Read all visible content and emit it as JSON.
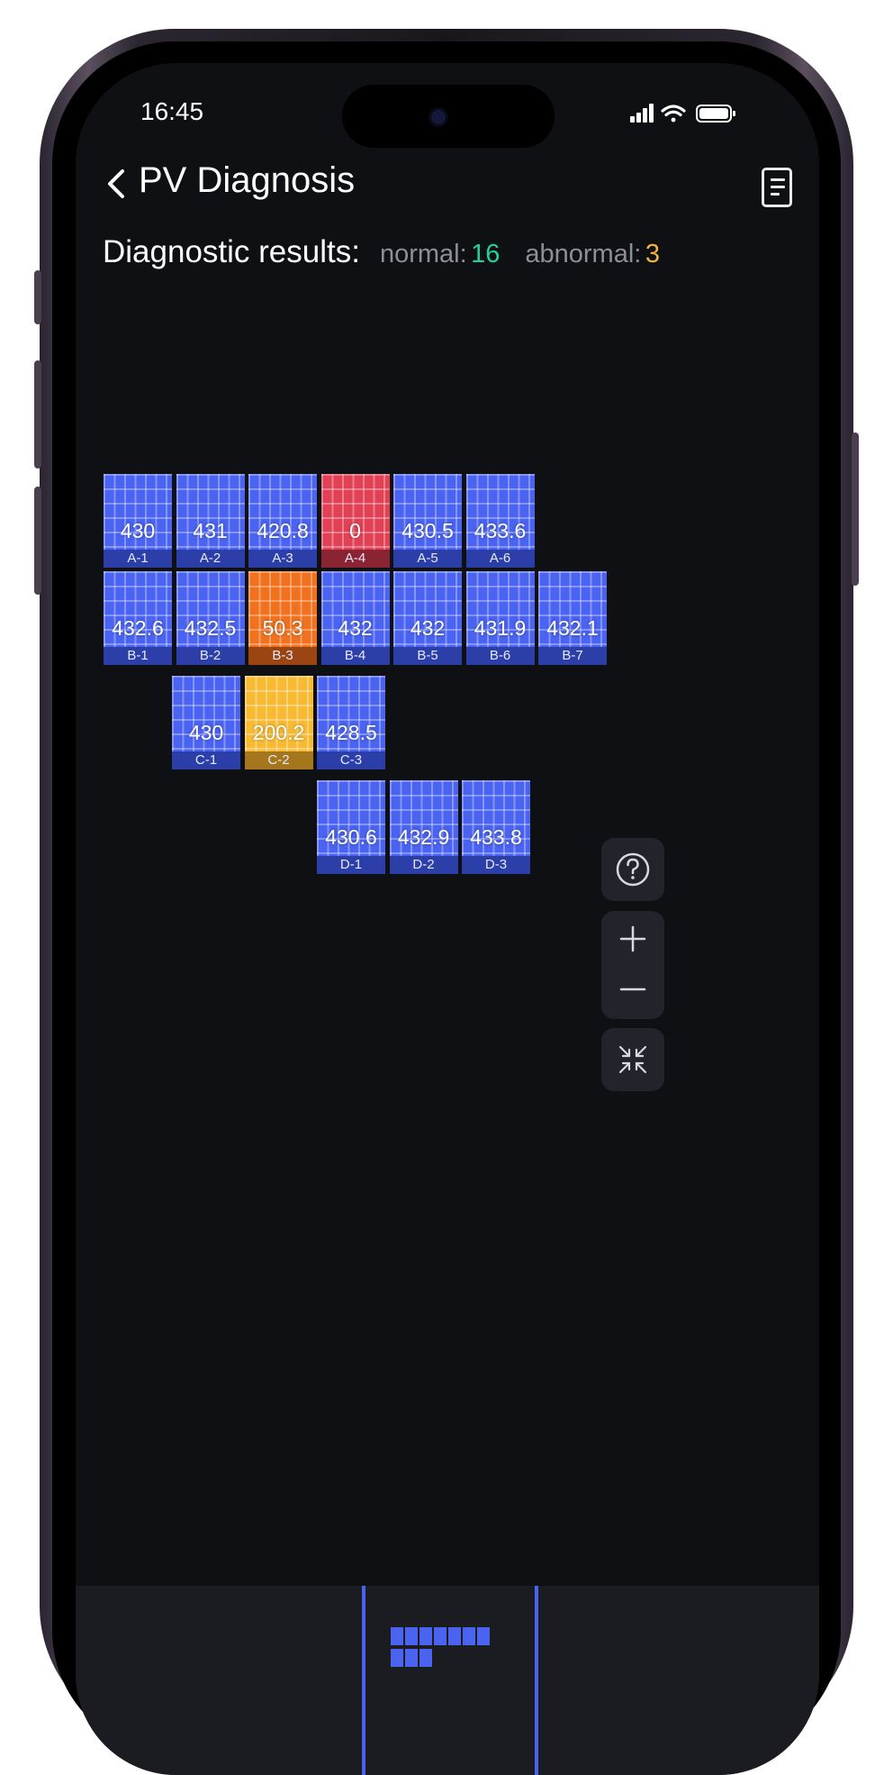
{
  "status_bar": {
    "time": "16:45"
  },
  "header": {
    "title": "PV Diagnosis"
  },
  "diagnostic": {
    "label": "Diagnostic results",
    "colon": ":",
    "normal_label": "normal:",
    "normal_count": "16",
    "abnormal_label": "abnormal:",
    "abnormal_count": "3"
  },
  "panels": [
    {
      "id": "A-1",
      "value": "430",
      "status": "normal"
    },
    {
      "id": "A-2",
      "value": "431",
      "status": "normal"
    },
    {
      "id": "A-3",
      "value": "420.8",
      "status": "normal"
    },
    {
      "id": "A-4",
      "value": "0",
      "status": "fault"
    },
    {
      "id": "A-5",
      "value": "430.5",
      "status": "normal"
    },
    {
      "id": "A-6",
      "value": "433.6",
      "status": "normal"
    },
    {
      "id": "B-1",
      "value": "432.6",
      "status": "normal"
    },
    {
      "id": "B-2",
      "value": "432.5",
      "status": "normal"
    },
    {
      "id": "B-3",
      "value": "50.3",
      "status": "severe"
    },
    {
      "id": "B-4",
      "value": "432",
      "status": "normal"
    },
    {
      "id": "B-5",
      "value": "432",
      "status": "normal"
    },
    {
      "id": "B-6",
      "value": "431.9",
      "status": "normal"
    },
    {
      "id": "B-7",
      "value": "432.1",
      "status": "normal"
    },
    {
      "id": "C-1",
      "value": "430",
      "status": "normal"
    },
    {
      "id": "C-2",
      "value": "200.2",
      "status": "warning"
    },
    {
      "id": "C-3",
      "value": "428.5",
      "status": "normal"
    },
    {
      "id": "D-1",
      "value": "430.6",
      "status": "normal"
    },
    {
      "id": "D-2",
      "value": "432.9",
      "status": "normal"
    },
    {
      "id": "D-3",
      "value": "433.8",
      "status": "normal"
    }
  ],
  "status_colors": {
    "normal": "#4a63f0",
    "fault": "#e04155",
    "severe": "#f0721f",
    "warning": "#f6ba33"
  },
  "controls": {
    "help_icon": "help-circle-icon",
    "zoom_in_icon": "plus-icon",
    "zoom_out_icon": "minus-icon",
    "fit_icon": "collapse-arrows-icon"
  },
  "bottom_nav": {
    "active_tab_icon": "panel-layout-icon"
  }
}
